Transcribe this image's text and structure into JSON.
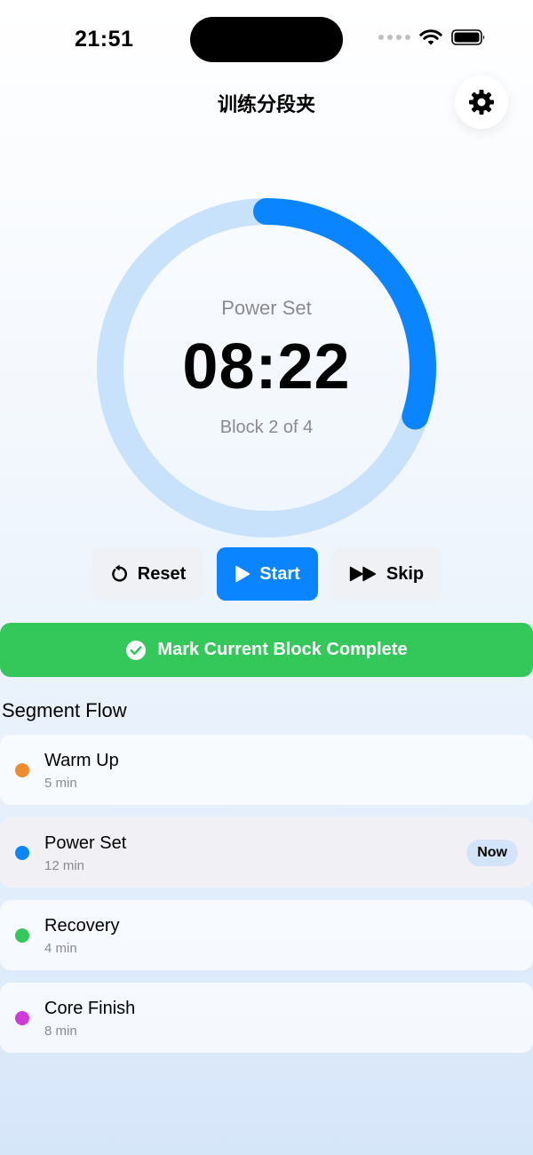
{
  "status_bar": {
    "time": "21:51"
  },
  "header": {
    "title": "训练分段夹",
    "settings_icon": "gear-icon"
  },
  "timer": {
    "segment_name": "Power Set",
    "time_remaining": "08:22",
    "block_label": "Block 2 of 4",
    "progress": 0.3,
    "track_color": "#c9e2fb",
    "progress_color": "#0a84ff"
  },
  "controls": {
    "reset_label": "Reset",
    "start_label": "Start",
    "skip_label": "Skip"
  },
  "complete_button": {
    "label": "Mark Current Block Complete",
    "color": "#34c759"
  },
  "segments_section": {
    "title": "Segment Flow",
    "items": [
      {
        "name": "Warm Up",
        "duration": "5 min",
        "color": "#f08c2e",
        "badge": ""
      },
      {
        "name": "Power Set",
        "duration": "12 min",
        "color": "#0a84ff",
        "badge": "Now"
      },
      {
        "name": "Recovery",
        "duration": "4 min",
        "color": "#34c759",
        "badge": ""
      },
      {
        "name": "Core Finish",
        "duration": "8 min",
        "color": "#cf3ad8",
        "badge": ""
      }
    ]
  }
}
